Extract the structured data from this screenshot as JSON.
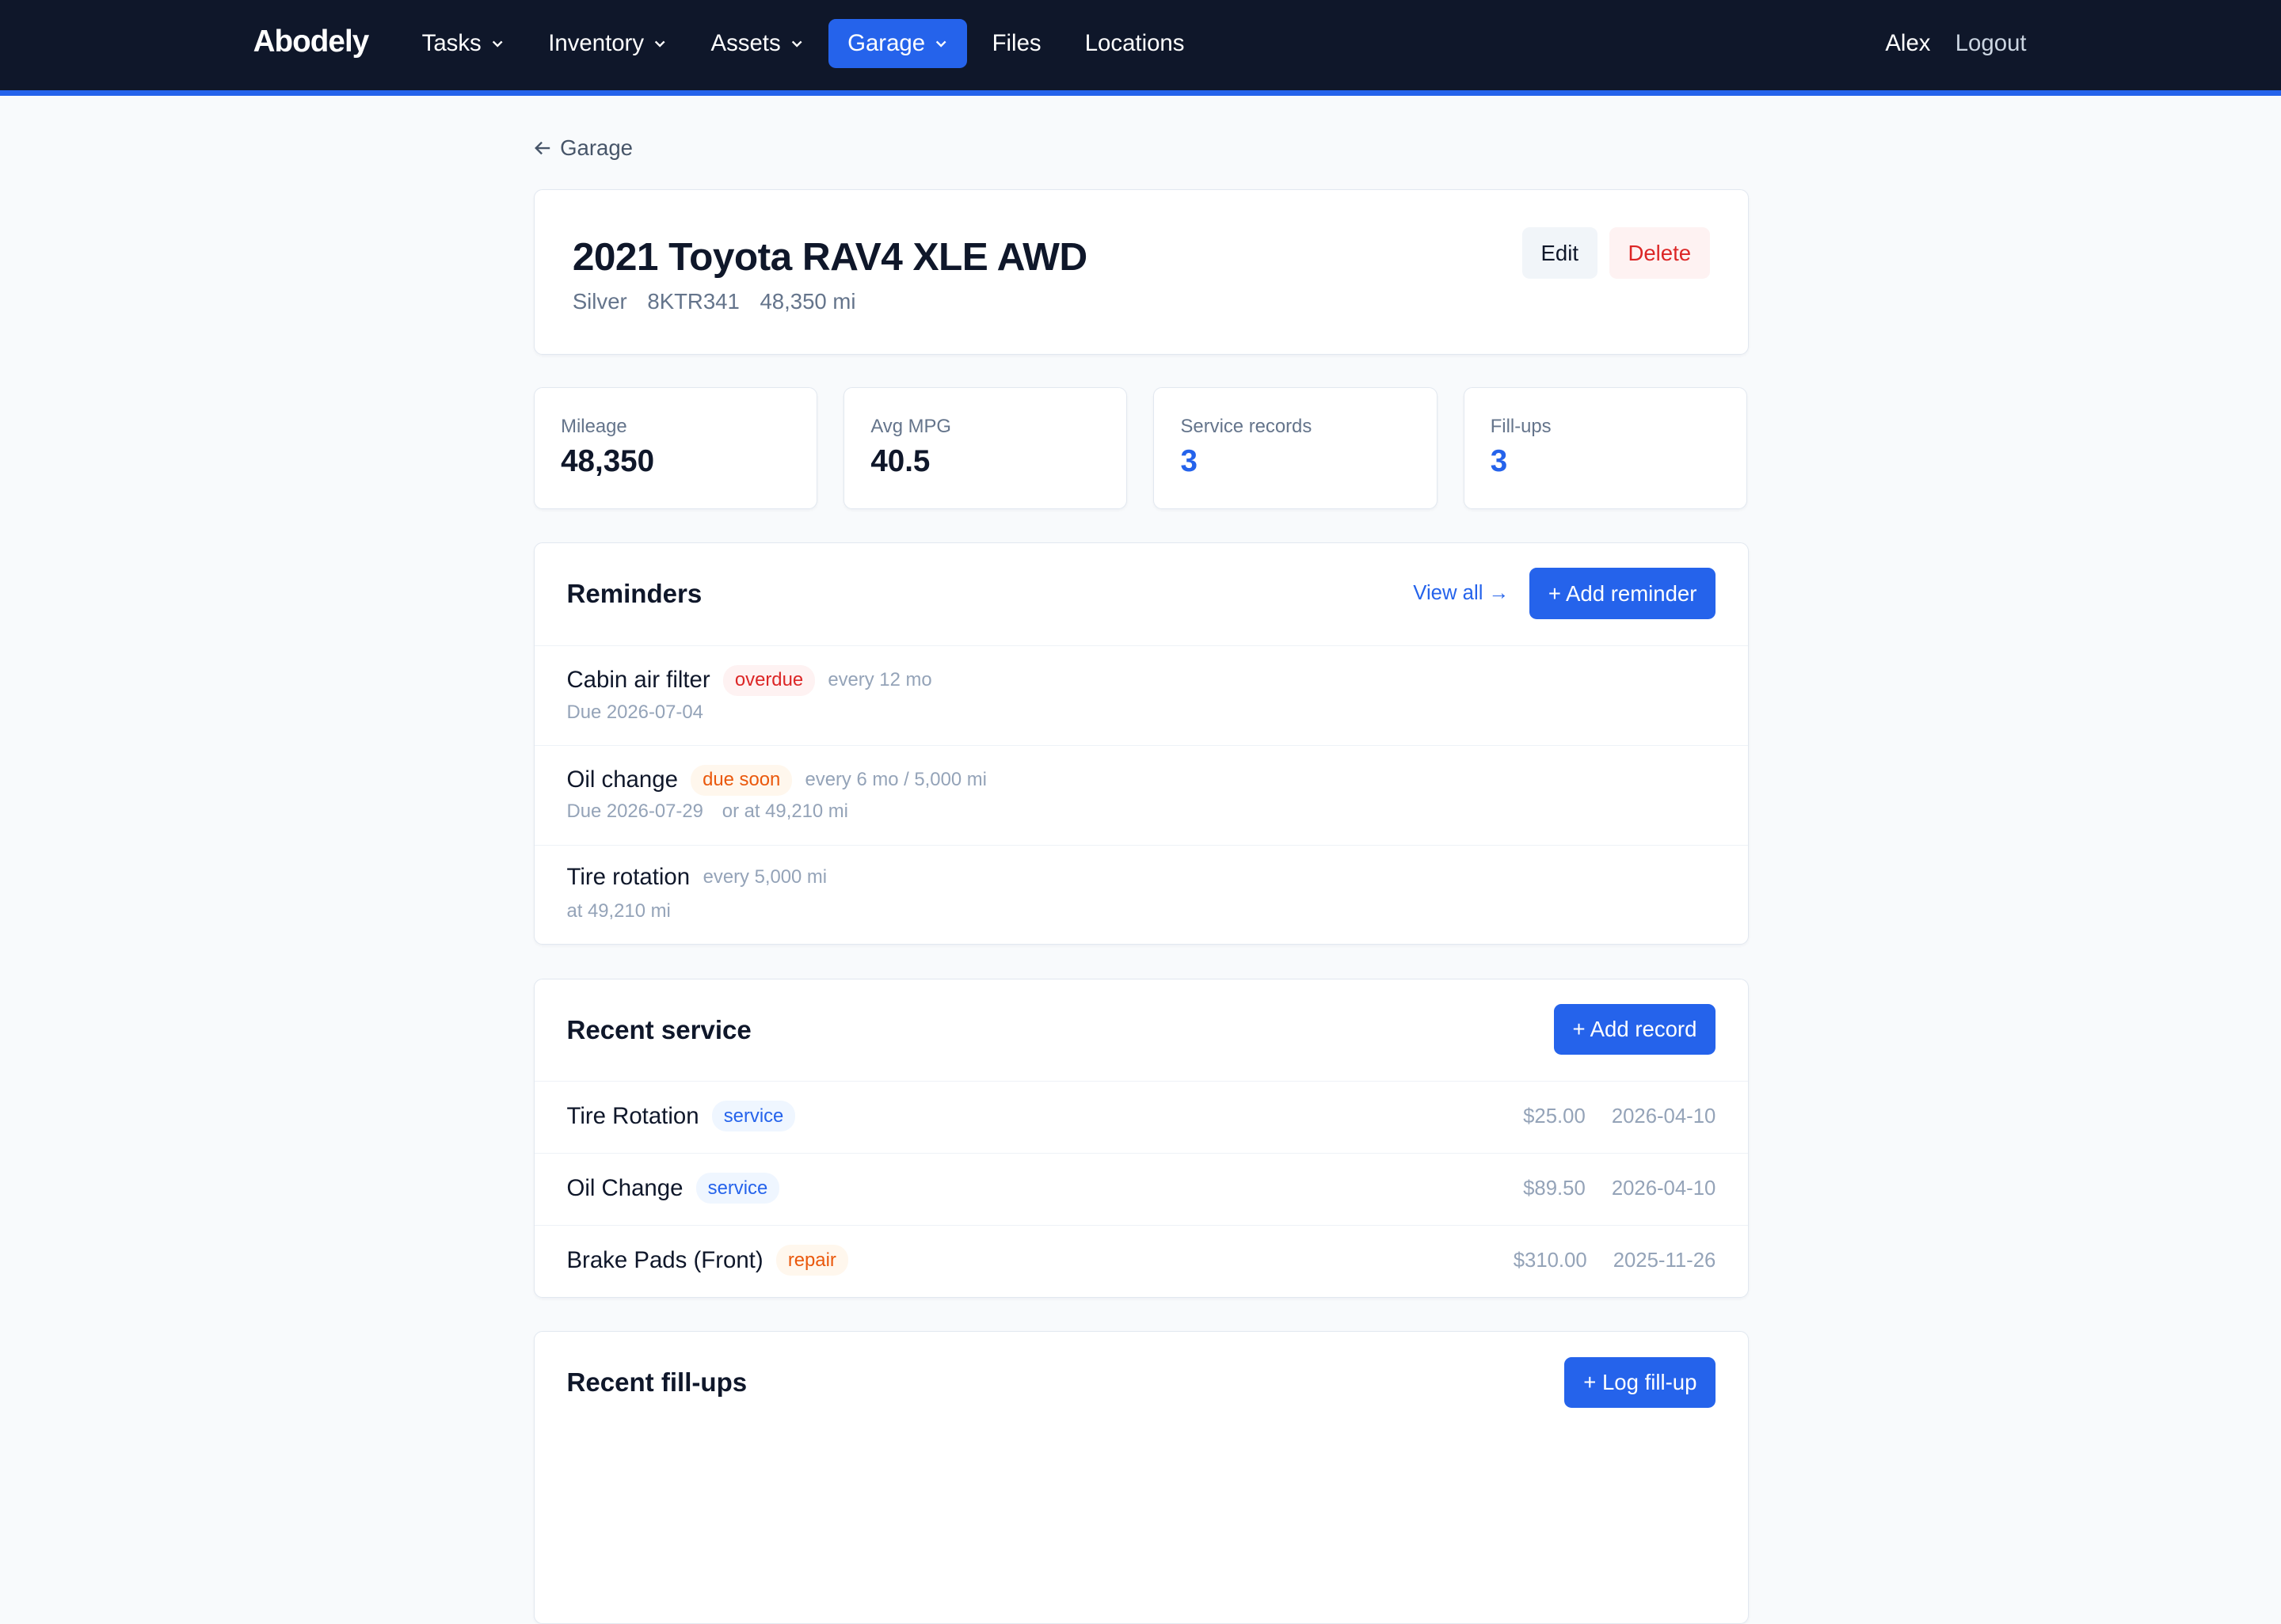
{
  "nav": {
    "brand": "Abodely",
    "items": [
      {
        "label": "Tasks",
        "dropdown": true
      },
      {
        "label": "Inventory",
        "dropdown": true
      },
      {
        "label": "Assets",
        "dropdown": true
      },
      {
        "label": "Garage",
        "dropdown": true,
        "active": true
      },
      {
        "label": "Files"
      },
      {
        "label": "Locations"
      }
    ],
    "user": "Alex",
    "logout": "Logout"
  },
  "back": {
    "label": "Garage",
    "icon": "arrow-left-icon"
  },
  "vehicle": {
    "title": "2021 Toyota RAV4 XLE AWD",
    "color": "Silver",
    "plate": "8KTR341",
    "odometer": "48,350 mi",
    "edit_label": "Edit",
    "delete_label": "Delete"
  },
  "stats": [
    {
      "label": "Mileage",
      "value": "48,350"
    },
    {
      "label": "Avg MPG",
      "value": "40.5"
    },
    {
      "label": "Service records",
      "value": "3"
    },
    {
      "label": "Fill-ups",
      "value": "3"
    }
  ],
  "reminders": {
    "title": "Reminders",
    "view_all": "View all →",
    "add_label": "+ Add reminder",
    "items": [
      {
        "name": "Cabin air filter",
        "badge": "overdue",
        "interval": "every 12 mo",
        "due": "Due 2026-07-04",
        "extra": ""
      },
      {
        "name": "Oil change",
        "badge": "due soon",
        "interval": "every 6 mo / 5,000 mi",
        "due": "Due 2026-07-29",
        "extra": "or at 49,210 mi"
      },
      {
        "name": "Tire rotation",
        "badge": "",
        "interval": "every 5,000 mi",
        "due": "at 49,210 mi",
        "extra": ""
      }
    ]
  },
  "service": {
    "title": "Recent service",
    "add_label": "+ Add record",
    "items": [
      {
        "name": "Tire Rotation",
        "type": "service",
        "cost": "$25.00",
        "date": "2026-04-10"
      },
      {
        "name": "Oil Change",
        "type": "service",
        "cost": "$89.50",
        "date": "2026-04-10"
      },
      {
        "name": "Brake Pads (Front)",
        "type": "repair",
        "cost": "$310.00",
        "date": "2025-11-26"
      }
    ]
  },
  "fillups": {
    "title": "Recent fill-ups",
    "add_label": "+ Log fill-up"
  },
  "colors": {
    "accent": "#2563eb",
    "nav_bg": "#0f172a",
    "danger": "#dc2626",
    "warning": "#ea580c"
  }
}
